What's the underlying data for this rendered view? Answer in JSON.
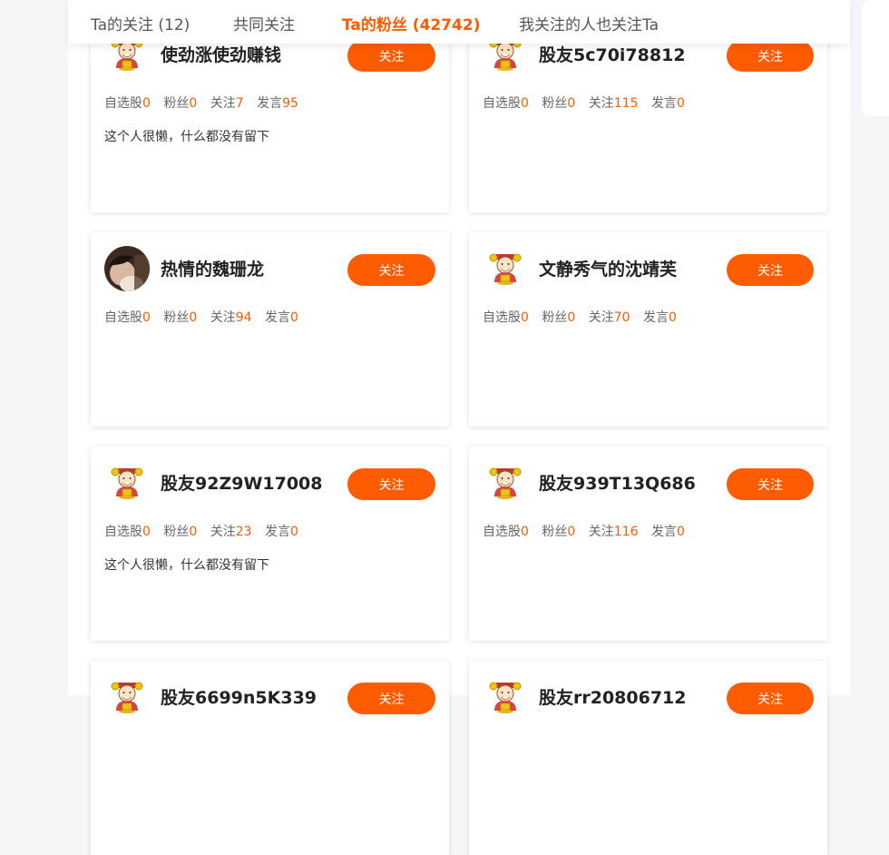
{
  "tabs": [
    {
      "label": "Ta的关注 (12)"
    },
    {
      "label": "共同关注"
    },
    {
      "label": "Ta的粉丝 (42742)"
    },
    {
      "label": "我关注的人也关注Ta"
    }
  ],
  "stat_labels": {
    "stocks": "自选股",
    "fans": "粉丝",
    "following": "关注",
    "posts": "发言"
  },
  "follow_label": "关注",
  "colors": {
    "accent": "#ff5b00",
    "page_bg": "#f5f6f8",
    "text_dark": "#222222",
    "text_muted": "#666666"
  },
  "cards": [
    {
      "name": "使劲涨使劲赚钱",
      "avatar": "mascot-icon",
      "stocks": "0",
      "fans": "0",
      "following": "7",
      "posts": "95",
      "bio": "这个人很懒，什么都没有留下"
    },
    {
      "name": "股友5c70i78812",
      "avatar": "mascot-icon",
      "stocks": "0",
      "fans": "0",
      "following": "115",
      "posts": "0",
      "bio": ""
    },
    {
      "name": "热情的魏珊龙",
      "avatar": "photo-avatar",
      "stocks": "0",
      "fans": "0",
      "following": "94",
      "posts": "0",
      "bio": ""
    },
    {
      "name": "文静秀气的沈靖芙",
      "avatar": "mascot-icon",
      "stocks": "0",
      "fans": "0",
      "following": "70",
      "posts": "0",
      "bio": ""
    },
    {
      "name": "股友92Z9W17008",
      "avatar": "mascot-icon",
      "stocks": "0",
      "fans": "0",
      "following": "23",
      "posts": "0",
      "bio": "这个人很懒，什么都没有留下"
    },
    {
      "name": "股友939T13Q686",
      "avatar": "mascot-icon",
      "stocks": "0",
      "fans": "0",
      "following": "116",
      "posts": "0",
      "bio": ""
    },
    {
      "name": "股友6699n5K339",
      "avatar": "mascot-icon",
      "stocks": "",
      "fans": "",
      "following": "",
      "posts": "",
      "bio": ""
    },
    {
      "name": "股友rr20806712",
      "avatar": "mascot-icon",
      "stocks": "",
      "fans": "",
      "following": "",
      "posts": "",
      "bio": ""
    }
  ]
}
